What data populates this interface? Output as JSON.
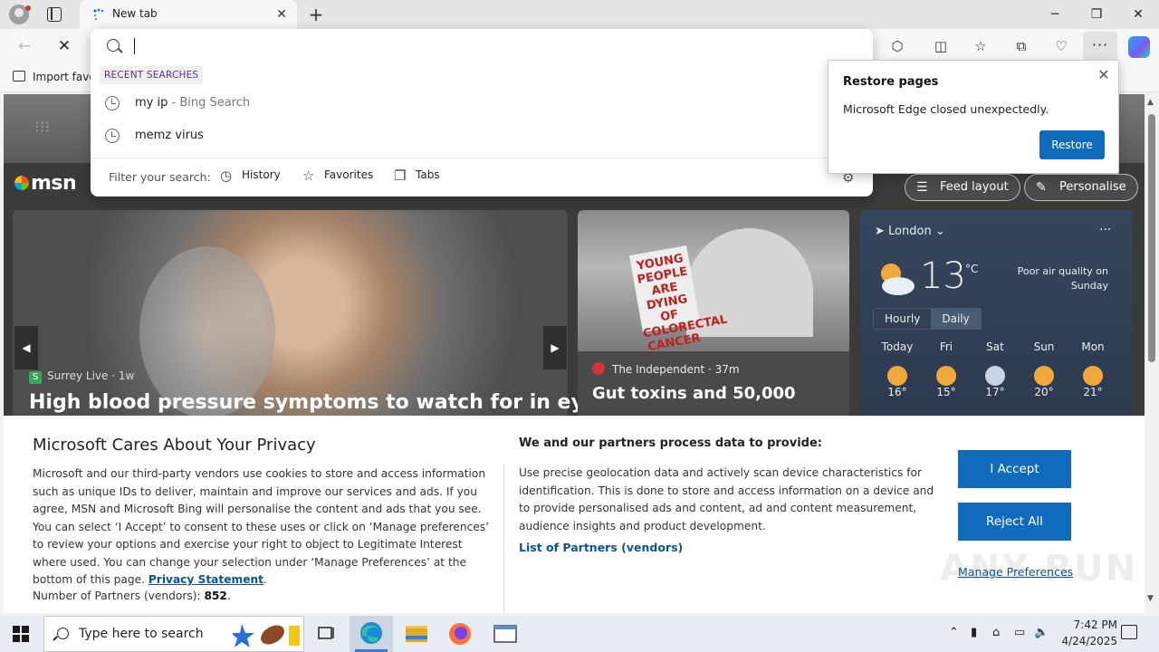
{
  "browser": {
    "tab_title": "New tab",
    "tab_close": "✕",
    "new_tab": "+",
    "window": {
      "minimize": "─",
      "maximize": "❐",
      "close": "✕"
    }
  },
  "favorites_bar": {
    "import_label": "Import favo"
  },
  "omnibox": {
    "value": "",
    "placeholder": "",
    "recent_label": "RECENT SEARCHES",
    "suggestions": [
      {
        "text": "my ip",
        "suffix": " - Bing Search"
      },
      {
        "text": "memz virus",
        "suffix": ""
      }
    ],
    "filter_label": "Filter your search:",
    "filters": [
      {
        "label": "History",
        "icon": "history-icon"
      },
      {
        "label": "Favorites",
        "icon": "star-icon"
      },
      {
        "label": "Tabs",
        "icon": "tabs-icon"
      }
    ]
  },
  "restore_popup": {
    "title": "Restore pages",
    "message": "Microsoft Edge closed unexpectedly.",
    "button": "Restore"
  },
  "msn": {
    "logo": "msn",
    "feed_layout": "Feed layout",
    "personalise": "Personalise",
    "hero": {
      "source": "Surrey Live",
      "age": "1w",
      "title": "High blood pressure symptoms to watch for in eyes"
    },
    "card2": {
      "source": "The Independent",
      "age": "37m",
      "title": "Gut toxins and 50,000",
      "sign_text": "YOUNG PEOPLE ARE DYING OF COLORECTAL CANCER"
    },
    "weather": {
      "location": "London",
      "temp": "13",
      "unit": "°C",
      "air_quality": "Poor air quality on Sunday",
      "tabs": [
        "Hourly",
        "Daily"
      ],
      "days": [
        {
          "day": "Today",
          "high": "16°"
        },
        {
          "day": "Fri",
          "high": "15°"
        },
        {
          "day": "Sat",
          "high": "17°"
        },
        {
          "day": "Sun",
          "high": "20°"
        },
        {
          "day": "Mon",
          "high": "21°"
        }
      ]
    }
  },
  "privacy": {
    "title": "Microsoft Cares About Your Privacy",
    "body": "Microsoft and our third-party vendors use cookies to store and access information such as unique IDs to deliver, maintain and improve our services and ads. If you agree, MSN and Microsoft Bing will personalise the content and ads that you see. You can select ‘I Accept’ to consent to these uses or click on ‘Manage preferences’ to review your options and exercise your right to object to Legitimate Interest where used.  You can change your selection under ‘Manage Preferences’ at the bottom of this page.",
    "privacy_link": "Privacy Statement",
    "partners_label": "Number of Partners (vendors):",
    "partners_count": "852",
    "col2_title": "We and our partners process data to provide:",
    "col2_body": "Use precise geolocation data and actively scan device characteristics for identification. This is done to store and access information on a device and to provide personalised ads and content, ad and content measurement, audience insights and product development.",
    "list_link": "List of Partners (vendors)",
    "accept": "I Accept",
    "reject": "Reject All",
    "manage": "Manage Preferences",
    "watermark": "ANY RUN"
  },
  "taskbar": {
    "search_placeholder": "Type here to search",
    "time": "7:42 PM",
    "date": "4/24/2025"
  },
  "colors": {
    "accent": "#0f6cbd",
    "link": "#0b5394"
  }
}
